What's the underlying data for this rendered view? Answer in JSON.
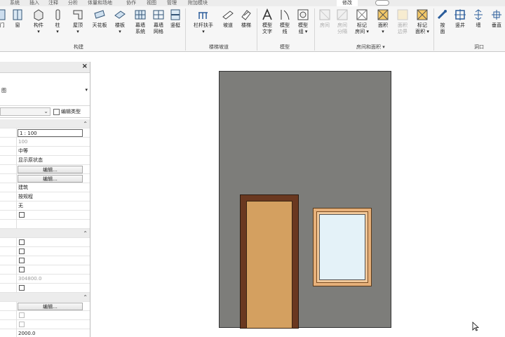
{
  "tabs": [
    "系统",
    "插入",
    "注释",
    "分析",
    "体量和场地",
    "协作",
    "视图",
    "管理",
    "附加模块",
    "修改"
  ],
  "ribbon": {
    "buttons": [
      {
        "name": "door",
        "label": "门"
      },
      {
        "name": "window",
        "label": "窗"
      },
      {
        "name": "component",
        "label": "构件\n▾"
      },
      {
        "name": "column",
        "label": "柱\n▾"
      },
      {
        "name": "roof",
        "label": "屋顶\n▾"
      },
      {
        "name": "ceiling",
        "label": "天花板"
      },
      {
        "name": "floor",
        "label": "楼板\n▾"
      },
      {
        "name": "curtain-system",
        "label": "幕墙\n系统"
      },
      {
        "name": "curtain-grid",
        "label": "幕墙\n网格"
      },
      {
        "name": "mullion",
        "label": "竖梃"
      },
      {
        "name": "railing",
        "label": "栏杆扶手\n▾"
      },
      {
        "name": "ramp",
        "label": "坡道"
      },
      {
        "name": "stair",
        "label": "楼梯"
      },
      {
        "name": "model-text",
        "label": "模型\n文字"
      },
      {
        "name": "model-line",
        "label": "模型\n线"
      },
      {
        "name": "model-group",
        "label": "模型\n组 ▾"
      },
      {
        "name": "room",
        "label": "房间",
        "disabled": true
      },
      {
        "name": "room-separator",
        "label": "房间\n分隔",
        "disabled": true
      },
      {
        "name": "tag-room",
        "label": "标记\n房间 ▾"
      },
      {
        "name": "area",
        "label": "面积\n▾"
      },
      {
        "name": "area-boundary",
        "label": "面积\n边界",
        "disabled": true
      },
      {
        "name": "tag-area",
        "label": "标记\n面积 ▾"
      },
      {
        "name": "by-face",
        "label": "按\n面"
      },
      {
        "name": "shaft",
        "label": "竖井"
      },
      {
        "name": "wall-opening",
        "label": "墙"
      },
      {
        "name": "vertical-opening",
        "label": "垂直"
      }
    ],
    "groups": [
      "构建",
      "楼梯坡道",
      "模型",
      "房间和面积 ▾",
      "洞口"
    ]
  },
  "properties": {
    "type_name": "图",
    "edit_type": "编辑类型",
    "rows": [
      {
        "kind": "section"
      },
      {
        "kind": "box",
        "value": "1 : 100"
      },
      {
        "kind": "text",
        "value": "100",
        "gray": true
      },
      {
        "kind": "text",
        "value": "中等"
      },
      {
        "kind": "text",
        "value": "显示原状态"
      },
      {
        "kind": "button",
        "value": "编辑..."
      },
      {
        "kind": "button",
        "value": "编辑..."
      },
      {
        "kind": "text",
        "value": "建筑"
      },
      {
        "kind": "text",
        "value": "按规程"
      },
      {
        "kind": "text",
        "value": "无"
      },
      {
        "kind": "check"
      },
      {
        "kind": "blank"
      },
      {
        "kind": "section"
      },
      {
        "kind": "check"
      },
      {
        "kind": "check"
      },
      {
        "kind": "check"
      },
      {
        "kind": "check"
      },
      {
        "kind": "text",
        "value": "304800.0",
        "gray": true
      },
      {
        "kind": "check"
      },
      {
        "kind": "section"
      },
      {
        "kind": "button",
        "value": "编辑..."
      },
      {
        "kind": "check",
        "dim": true
      },
      {
        "kind": "check",
        "dim": true
      },
      {
        "kind": "text",
        "value": "2000.0"
      }
    ]
  },
  "colors": {
    "wall": "#7d7d7a",
    "door": "#d4a060",
    "door_frame": "#6a3820",
    "glass": "#e4f2f8"
  }
}
